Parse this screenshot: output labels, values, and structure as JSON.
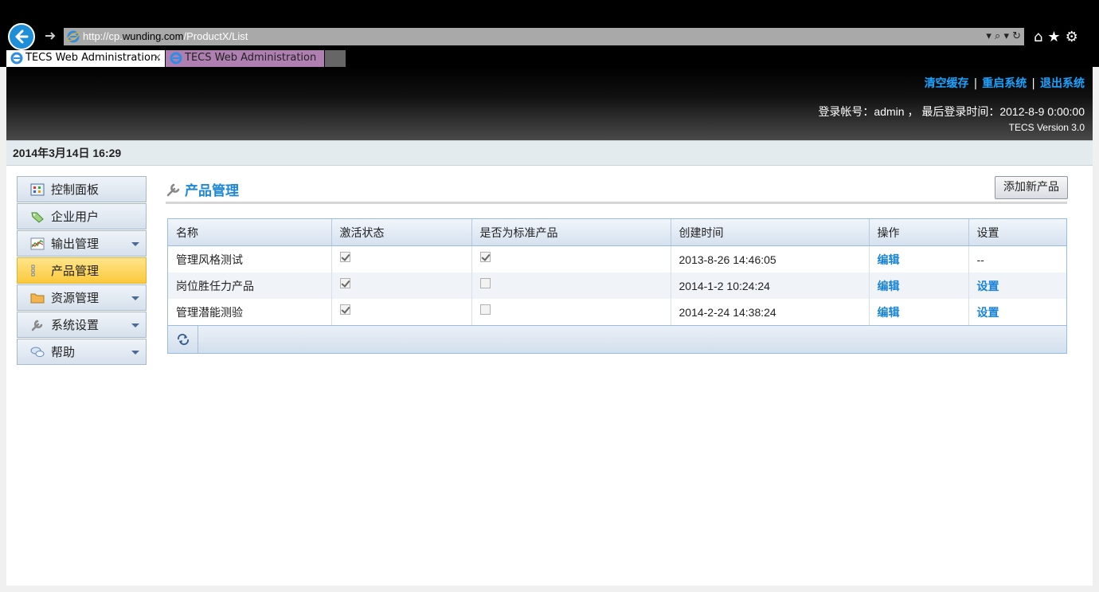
{
  "browser": {
    "url_prefix": "http://cp.",
    "url_host": "wunding.com",
    "url_path": "/ProductX/List",
    "address_tools": "▾ ⌕ ▾ ↻",
    "right_icons": "⌂★⚙",
    "tabs": [
      {
        "label": "TECS Web Administration.",
        "close": "×"
      },
      {
        "label": "TECS Web Administration"
      }
    ]
  },
  "header": {
    "links": [
      "清空缓存",
      "重启系统",
      "退出系统"
    ],
    "separator": "|",
    "login_info": "登录帐号：admin ， 最后登录时间：2012-8-9 0:00:00",
    "version": "TECS Version 3.0"
  },
  "date_bar": "2014年3月14日 16:29",
  "sidebar": {
    "items": [
      {
        "label": "控制面板",
        "icon": "dashboard-icon"
      },
      {
        "label": "企业用户",
        "icon": "tag-icon"
      },
      {
        "label": "输出管理",
        "icon": "chart-icon",
        "has_caret": true
      },
      {
        "label": "产品管理",
        "icon": "list-icon",
        "active": true
      },
      {
        "label": "资源管理",
        "icon": "folder-icon",
        "has_caret": true
      },
      {
        "label": "系统设置",
        "icon": "wrench-icon",
        "has_caret": true
      },
      {
        "label": "帮助",
        "icon": "chat-icon",
        "has_caret": true
      }
    ]
  },
  "main": {
    "title": "产品管理",
    "add_button": "添加新产品",
    "columns": [
      "名称",
      "激活状态",
      "是否为标准产品",
      "创建时间",
      "操作",
      "设置"
    ],
    "rows": [
      {
        "name": "管理风格测试",
        "active": true,
        "standard": true,
        "created": "2013-8-26 14:46:05",
        "action": "编辑",
        "setting": "--"
      },
      {
        "name": "岗位胜任力产品",
        "active": true,
        "standard": false,
        "created": "2014-1-2 10:24:24",
        "action": "编辑",
        "setting": "设置"
      },
      {
        "name": "管理潜能测验",
        "active": true,
        "standard": false,
        "created": "2014-2-24 14:38:24",
        "action": "编辑",
        "setting": "设置"
      }
    ]
  },
  "colors": {
    "link": "#1a84d6",
    "title": "#1e88d8",
    "active_nav": "#fbc93c"
  }
}
